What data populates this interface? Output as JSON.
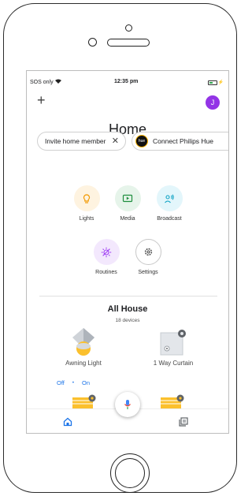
{
  "status_bar": {
    "carrier": "SOS only",
    "time": "12:35 pm"
  },
  "header": {
    "add_icon": "+",
    "avatar_letter": "J",
    "title": "Home"
  },
  "chips": [
    {
      "label": "Invite home member",
      "dismiss": "✕"
    },
    {
      "label": "Connect Philips Hue",
      "logo": "hue"
    }
  ],
  "actions": [
    {
      "label": "Lights",
      "icon": "bulb-icon"
    },
    {
      "label": "Media",
      "icon": "media-icon"
    },
    {
      "label": "Broadcast",
      "icon": "broadcast-icon"
    },
    {
      "label": "Routines",
      "icon": "routines-icon"
    },
    {
      "label": "Settings",
      "icon": "gear-icon"
    }
  ],
  "room": {
    "name": "All House",
    "device_count": "18 devices"
  },
  "devices": [
    {
      "name": "Awning Light",
      "off_label": "Off",
      "on_label": "On"
    },
    {
      "name": "1 Way Curtain"
    }
  ],
  "colors": {
    "accent": "#1a73e8",
    "avatar": "#9334e6",
    "mic_red": "#ea4335"
  }
}
